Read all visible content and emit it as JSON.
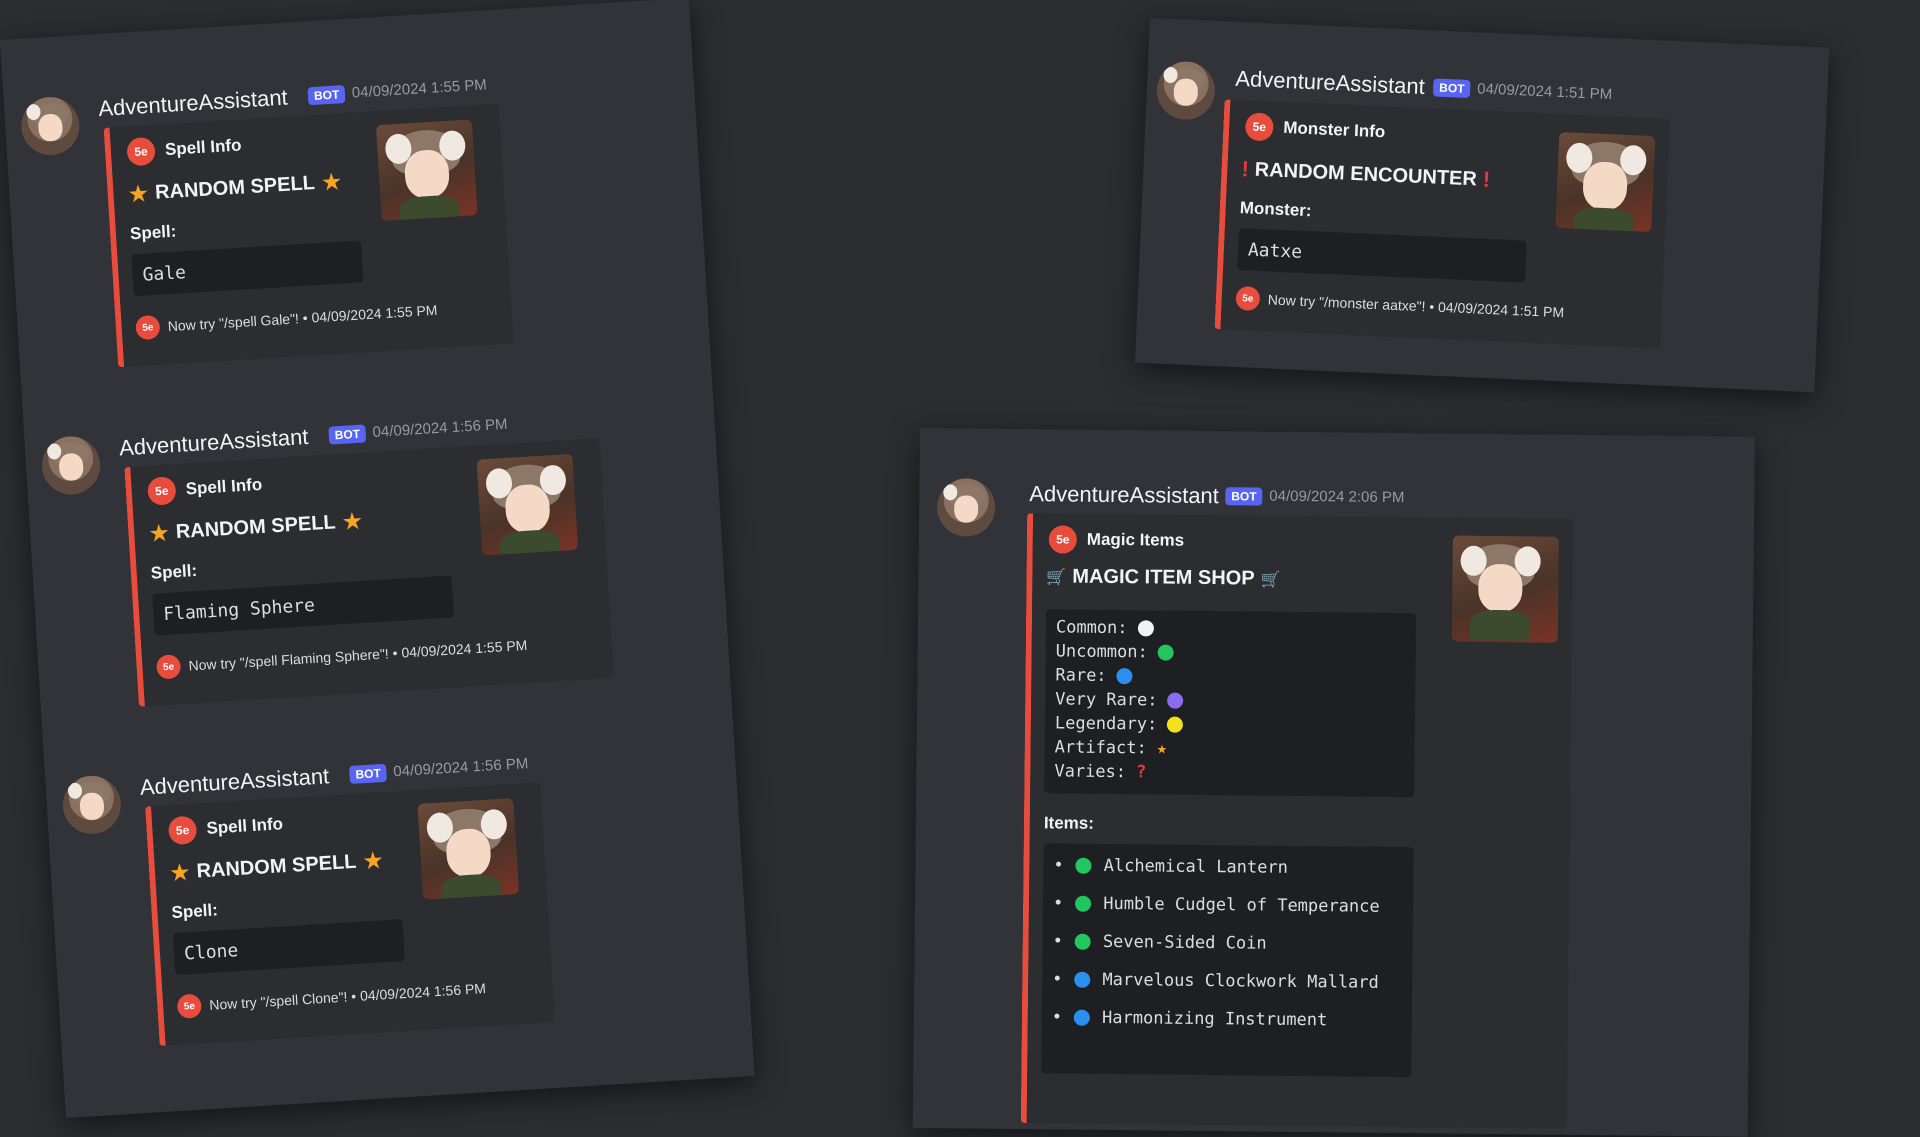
{
  "bot": {
    "name": "AdventureAssistant",
    "tag": "BOT",
    "badge_text": "5e"
  },
  "colors": {
    "embed_accent": "#e74c3c",
    "bot_tag": "#5865f2",
    "common": "#f2f2f2",
    "uncommon": "#22c55e",
    "rare": "#2b8ff0",
    "very_rare": "#8b6cf0",
    "legendary": "#f5e11a",
    "artifact": "#f5a524",
    "varies": "#e23b3b"
  },
  "spell_messages": [
    {
      "timestamp": "04/09/2024 1:55 PM",
      "author": "Spell Info",
      "title": "RANDOM SPELL",
      "field_name": "Spell:",
      "value": "Gale",
      "footer": "Now try \"/spell Gale\"! • 04/09/2024 1:55 PM"
    },
    {
      "timestamp": "04/09/2024 1:56 PM",
      "author": "Spell Info",
      "title": "RANDOM SPELL",
      "field_name": "Spell:",
      "value": "Flaming Sphere",
      "footer": "Now try \"/spell Flaming Sphere\"! • 04/09/2024 1:55 PM"
    },
    {
      "timestamp": "04/09/2024 1:56 PM",
      "author": "Spell Info",
      "title": "RANDOM SPELL",
      "field_name": "Spell:",
      "value": "Clone",
      "footer": "Now try \"/spell Clone\"! • 04/09/2024 1:56 PM"
    }
  ],
  "monster_message": {
    "timestamp": "04/09/2024 1:51 PM",
    "author": "Monster Info",
    "title": "RANDOM ENCOUNTER",
    "field_name": "Monster:",
    "value": "Aatxe",
    "footer": "Now try \"/monster aatxe\"! • 04/09/2024 1:51 PM"
  },
  "shop_message": {
    "timestamp": "04/09/2024 2:06 PM",
    "author": "Magic Items",
    "title": "MAGIC ITEM SHOP",
    "legend": [
      {
        "label": "Common:",
        "symbol": "dot",
        "color_key": "common"
      },
      {
        "label": "Uncommon:",
        "symbol": "dot",
        "color_key": "uncommon"
      },
      {
        "label": "Rare:",
        "symbol": "dot",
        "color_key": "rare"
      },
      {
        "label": "Very Rare:",
        "symbol": "dot",
        "color_key": "very_rare"
      },
      {
        "label": "Legendary:",
        "symbol": "dot",
        "color_key": "legendary"
      },
      {
        "label": "Artifact:",
        "symbol": "star",
        "color_key": "artifact"
      },
      {
        "label": "Varies:",
        "symbol": "question",
        "color_key": "varies"
      }
    ],
    "items_label": "Items:",
    "items": [
      {
        "name": "Alchemical Lantern",
        "rarity": "uncommon"
      },
      {
        "name": "Humble Cudgel of Temperance",
        "rarity": "uncommon"
      },
      {
        "name": "Seven-Sided Coin",
        "rarity": "uncommon"
      },
      {
        "name": "Marvelous Clockwork Mallard",
        "rarity": "rare"
      },
      {
        "name": "Harmonizing Instrument",
        "rarity": "rare"
      }
    ]
  }
}
